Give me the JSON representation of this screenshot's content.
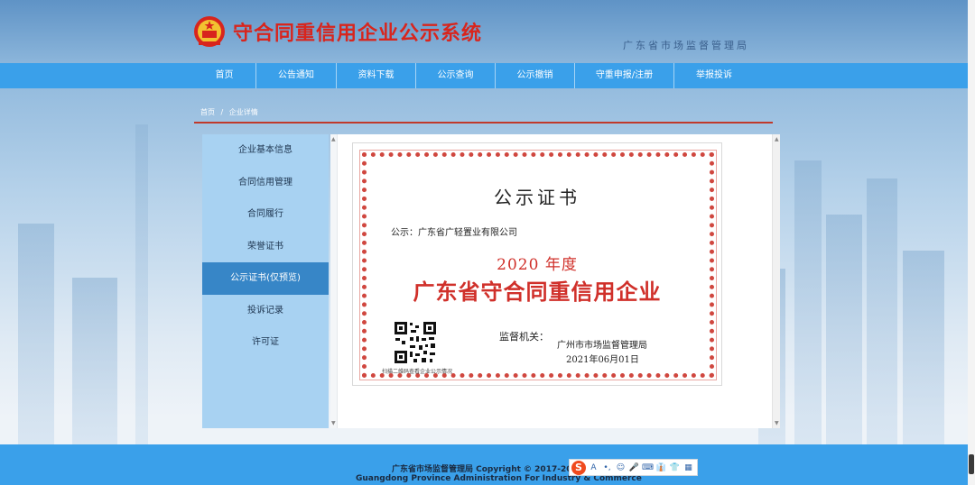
{
  "header": {
    "title": "守合同重信用企业公示系统",
    "agency": "广东省市场监督管理局"
  },
  "nav": {
    "items": [
      {
        "label": "首页",
        "width": 70
      },
      {
        "label": "公告通知",
        "width": 89
      },
      {
        "label": "资料下载",
        "width": 88
      },
      {
        "label": "公示查询",
        "width": 88
      },
      {
        "label": "公示撤销",
        "width": 88
      },
      {
        "label": "守重申报/注册",
        "width": 110
      },
      {
        "label": "举报投诉",
        "width": 88
      }
    ]
  },
  "breadcrumb": {
    "home": "首页",
    "separator": "/",
    "current": "企业详情"
  },
  "sidebar": {
    "items": [
      {
        "label": "企业基本信息",
        "active": false
      },
      {
        "label": "合同信用管理",
        "active": false
      },
      {
        "label": "合同履行",
        "active": false
      },
      {
        "label": "荣誉证书",
        "active": false
      },
      {
        "label": "公示证书(仅预览)",
        "active": true
      },
      {
        "label": "投诉记录",
        "active": false
      },
      {
        "label": "许可证",
        "active": false
      }
    ]
  },
  "certificate": {
    "title": "公示证书",
    "recipient": "公示：广东省广轻置业有限公司",
    "year": "2020 年度",
    "honor": "广东省守合同重信用企业",
    "authority_label": "监督机关：",
    "authority": "广州市市场监督管理局",
    "date": "2021年06月01日",
    "qr_caption": "扫描二维码查看企业公示情况"
  },
  "footer": {
    "line1": "广东省市场监督管理局 Copyright © 2017-2019",
    "line2": "Guangdong Province Administration For Industry & Commerce"
  },
  "ime": {
    "logo": "S",
    "buttons": [
      "A",
      "•,",
      "☺",
      "🎤",
      "⌨",
      "👔",
      "👕",
      "▦"
    ]
  },
  "colors": {
    "nav": "#3aa0ea",
    "title_red": "#d8251d",
    "sidebar": "#a8d2f2",
    "sidebar_active": "#3786c7"
  }
}
